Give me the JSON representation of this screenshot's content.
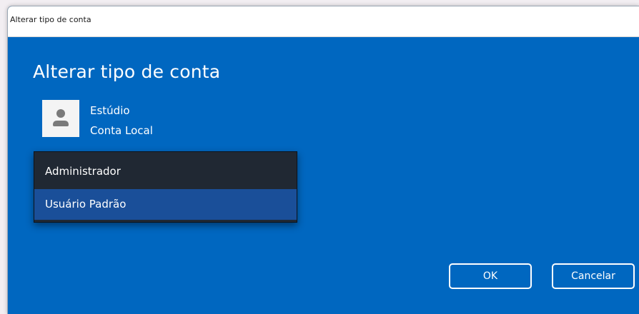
{
  "window": {
    "title": "Alterar tipo de conta"
  },
  "main": {
    "heading": "Alterar tipo de conta",
    "account": {
      "name": "Estúdio",
      "type": "Conta Local",
      "avatar_icon": "user-avatar-icon"
    },
    "account_type_options": [
      {
        "label": "Administrador",
        "selected": false
      },
      {
        "label": "Usuário Padrão",
        "selected": true
      }
    ]
  },
  "buttons": {
    "ok_label": "OK",
    "cancel_label": "Cancelar"
  },
  "colors": {
    "dialog_background": "#0067c0",
    "dropdown_background": "#202833",
    "selected_option": "#1a4f99",
    "titlebar": "#ffffff"
  }
}
